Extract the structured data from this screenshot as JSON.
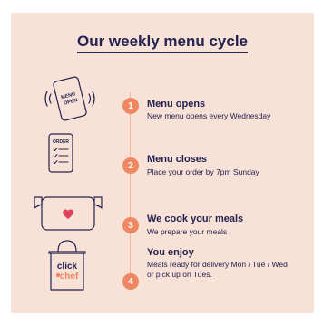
{
  "title": "Our weekly menu cycle",
  "colors": {
    "background": "#f8e1d6",
    "navy": "#242350",
    "accent": "#ef8862",
    "heart": "#e0405a"
  },
  "steps": [
    {
      "number": "1",
      "title": "Menu opens",
      "description": "New menu opens every Wednesday",
      "icon": "phone-menu-open-icon",
      "icon_text_1": "MENU",
      "icon_text_2": "OPEN"
    },
    {
      "number": "2",
      "title": "Menu closes",
      "description": "Place your order by 7pm Sunday",
      "icon": "order-list-icon",
      "icon_text_1": "ORDER"
    },
    {
      "number": "3",
      "title": "We cook your meals",
      "description": "We prepare your meals",
      "icon": "cooking-pot-icon"
    },
    {
      "number": "4",
      "title": "You enjoy",
      "description": "Meals ready for delivery Mon / Tue / Wed or pick up on Tues.",
      "icon": "shopping-bag-icon",
      "brand_text_1": "click",
      "brand_text_2": "chef"
    }
  ]
}
